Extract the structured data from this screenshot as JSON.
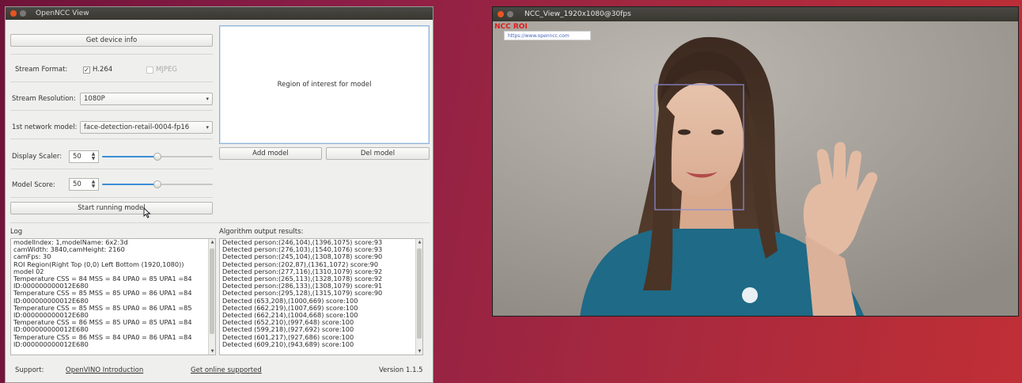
{
  "left_window": {
    "title": "OpenNCC View",
    "get_device_info": "Get device info",
    "stream_format_label": "Stream Format:",
    "h264": {
      "label": "H.264",
      "checked": true,
      "mark": "✓"
    },
    "mjpeg": {
      "label": "MJPEG",
      "checked": false,
      "disabled": true,
      "mark": ""
    },
    "resolution_label": "Stream Resolution:",
    "resolution_value": "1080P",
    "network_label": "1st network model:",
    "network_value": "face-detection-retail-0004-fp16",
    "display_scaler_label": "Display Scaler:",
    "display_scaler_value": "50",
    "display_scaler_level": 0.5,
    "model_score_label": "Model Score:",
    "model_score_value": "50",
    "model_score_level": 0.5,
    "start_button": "Start running model",
    "roi_text": "Region of interest for model",
    "add_model": "Add model",
    "del_model": "Del model",
    "log_label": "Log",
    "algo_label": "Algorithm output results:",
    "log_lines": [
      "modelIndex: 1,modelName: 6x2:3d",
      "camWidth: 3840,camHeight: 2160",
      "camFps: 30",
      "ROI Region(Right Top (0,0) Left Bottom (1920,1080))",
      "model 02",
      "Temperature CSS = 84 MSS = 84 UPA0 = 85 UPA1 =84",
      "ID:000000000012E680",
      "Temperature CSS = 85 MSS = 85 UPA0 = 86 UPA1 =84",
      "ID:000000000012E680",
      "Temperature CSS = 85 MSS = 85 UPA0 = 86 UPA1 =85",
      "ID:000000000012E680",
      "Temperature CSS = 86 MSS = 85 UPA0 = 85 UPA1 =84",
      "ID:000000000012E680",
      "Temperature CSS = 86 MSS = 84 UPA0 = 86 UPA1 =84",
      "ID:000000000012E680"
    ],
    "algo_lines": [
      "Detected person:(246,104),(1396,1075) score:93",
      "Detected person:(276,103),(1540,1076) score:93",
      "Detected person:(245,104),(1308,1078) score:90",
      "Detected person:(202,87),(1361,1072) score:90",
      "Detected person:(277,116),(1310,1079) score:92",
      "Detected person:(265,113),(1328,1078) score:92",
      "Detected person:(286,133),(1308,1079) score:91",
      "Detected person:(295,128),(1315,1079) score:90",
      "Detected (653,208),(1000,669) score:100",
      "Detected (662,219),(1007,669) score:100",
      "Detected (662,214),(1004,668) score:100",
      "Detected (652,210),(997,648) score:100",
      "Detected (599,218),(927,692) score:100",
      "Detected (601,217),(927,686) score:100",
      "Detected (609,210),(943,689) score:100"
    ],
    "support_label": "Support:",
    "link_openvino": "OpenVINO Introduction",
    "link_online": "Get online supported",
    "version": "Version 1.1.5"
  },
  "right_window": {
    "title": "NCC_View_1920x1080@30fps",
    "roi_label": "NCC ROI",
    "url": "https://www.openncc.com"
  },
  "colors": {
    "accent": "#e95420",
    "slider_fill": "#3b8fd6",
    "roi_label": "#e21b1b",
    "detection_box": "#8d8fd8",
    "polo_shirt": "#1f6a86"
  },
  "icons": {
    "cursor": "mouse-pointer-icon",
    "combo_arrow": "chevron-down-icon",
    "spin": "spin-up-down-icon"
  }
}
